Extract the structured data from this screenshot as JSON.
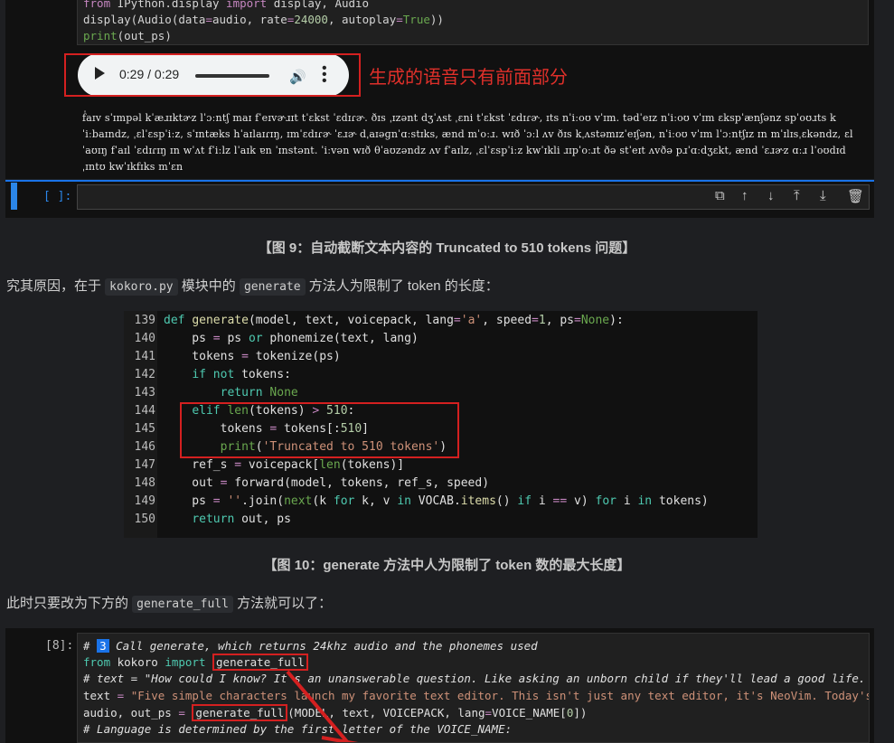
{
  "top_cell": {
    "lines": [
      "from IPython.display import display, Audio",
      "display(Audio(data=audio, rate=24000, autoplay=True))",
      "print(out_ps)"
    ],
    "audio": {
      "time": "0:29 / 0:29",
      "play_icon": "play-icon",
      "volume_icon": "volume-icon",
      "more_icon": "more-options-icon"
    },
    "annotation": "生成的语音只有前面部分",
    "phonemes": "f̍aɪv sˈɪmpəl kˈæɹɪktɚz lˈɔːntʃ maɪ fˈeɪvɚɹɪt tˈɛkst ˈɛdɪɾɚ. ðɪs ˌɪzənt dʒˈʌst ˌɛni tˈɛkst ˈɛdɪɾɚ, ɪts nˈiːoʊ vˈɪm. tədˈeɪz nˈiːoʊ vˈɪm ɛkspˈænʃənz spˈoʊɹts kˈiːbaɪndz, ˌɛlˈɛspˈiːz, sˈɪntæks hˈaɪlaɪɾɪŋ, ɪmˈɛdɪɾɚ ˈɛɹɚ dˌaɪəɡnˈɑːstɪks, ænd mˈoːɹ. wɪð ˈɔːl ʌv ðɪs kˌʌstəmɪzˈeɪʃən, nˈiːoʊ vˈɪm lˈɔːntʃɪz ɪn mˈɪlɪsˌɛkəndz, ɛlˈaʊɪŋ fˈaɪl ˈɛdɪɾɪŋ ɪn wˈʌt fˈiːlz lˈaɪk ɐn ˈɪnstənt. ˈiːvən wɪð θˈaʊzəndz ʌv fˈaɪlz, ˌɛlˈɛspˈiːz kwˈɪkli ɹɪpˈoːɹt ðə stˈeɪt ʌvðə pɹˈɑːdʒɛkt, ænd ˈɛɹɚz ɑːɹ lˈoʊdɪd ˌɪntʊ kwˈɪkfɪks mˈɛn"
  },
  "empty_cell": {
    "prompt": "[ ]:",
    "tools": [
      "copy-icon",
      "move-up-icon",
      "move-down-icon",
      "insert-above-icon",
      "insert-below-icon",
      "delete-icon"
    ]
  },
  "caption9": "【图 9：自动截断文本内容的 Truncated to 510 tokens 问题】",
  "para1": {
    "a": "究其原因，在于 ",
    "code1": "kokoro.py",
    "b": " 模块中的 ",
    "code2": "generate",
    "c": " 方法人为限制了 token 的长度："
  },
  "code_block": {
    "line_numbers": [
      "139",
      "140",
      "141",
      "142",
      "143",
      "144",
      "145",
      "146",
      "147",
      "148",
      "149",
      "150"
    ]
  },
  "caption10": "【图 10：generate 方法中人为限制了 token 数的最大长度】",
  "para2": {
    "a": "此时只要改为下方的 ",
    "code": "generate_full",
    "b": " 方法就可以了："
  },
  "bottom_cell": {
    "prompt": "[8]:"
  }
}
